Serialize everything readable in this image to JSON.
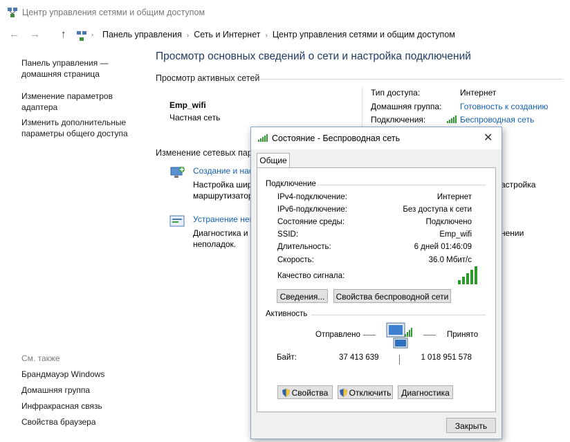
{
  "window": {
    "title": "Центр управления сетями и общим доступом"
  },
  "nav": {
    "back": "←",
    "forward": "→",
    "up": "↑",
    "breadcrumbs": [
      "Панель управления",
      "Сеть и Интернет",
      "Центр управления сетями и общим доступом"
    ]
  },
  "sidebar": {
    "home": "Панель управления — домашняя страница",
    "items": [
      "Изменение параметров адаптера",
      "Изменить дополнительные параметры общего доступа"
    ],
    "see_also_title": "См. также",
    "see_also": [
      "Брандмауэр Windows",
      "Домашняя группа",
      "Инфракрасная связь",
      "Свойства браузера"
    ]
  },
  "main": {
    "title": "Просмотр основных сведений о сети и настройка подключений",
    "active_networks_header": "Просмотр активных сетей",
    "network_name": "Emp_wifi",
    "network_type": "Частная сеть",
    "access_type_label": "Тип доступа:",
    "access_type_value": "Интернет",
    "homegroup_label": "Домашняя группа:",
    "homegroup_value": "Готовность к созданию",
    "connections_label": "Подключения:",
    "connections_value": "Беспроводная сеть",
    "change_settings_header": "Изменение сетевых пара",
    "task1_link": "Создание и нас",
    "task1_desc_line1": "Настройка шир",
    "task1_desc_line2": "маршрутизатор",
    "task1_right_fragment": "астройка",
    "task2_link": "Устранение неп",
    "task2_desc_line1": "Диагностика и",
    "task2_desc_line2": "неполадок.",
    "task2_right_fragment": "нении"
  },
  "dialog": {
    "title": "Состояние - Беспроводная сеть",
    "close": "✕",
    "tab": "Общие",
    "connection_group": "Подключение",
    "rows": [
      {
        "label": "IPv4-подключение:",
        "value": "Интернет"
      },
      {
        "label": "IPv6-подключение:",
        "value": "Без доступа к сети"
      },
      {
        "label": "Состояние среды:",
        "value": "Подключено"
      },
      {
        "label": "SSID:",
        "value": "Emp_wifi"
      },
      {
        "label": "Длительность:",
        "value": "6 дней 01:46:09"
      },
      {
        "label": "Скорость:",
        "value": "36.0 Мбит/с"
      }
    ],
    "signal_label": "Качество сигнала:",
    "signal_bars": 5,
    "details_button": "Сведения...",
    "wireless_props_button": "Свойства беспроводной сети",
    "activity_group": "Активность",
    "sent_label": "Отправлено",
    "received_label": "Принято",
    "bytes_label": "Байт:",
    "bytes_sent": "37 413 639",
    "bytes_received": "1 018 951 578",
    "properties_button": "Свойства",
    "disable_button": "Отключить",
    "diagnostics_button": "Диагностика",
    "close_button": "Закрыть"
  },
  "colors": {
    "link": "#1560b2",
    "title": "#1e3a64",
    "signal": "#2e9a2e"
  }
}
